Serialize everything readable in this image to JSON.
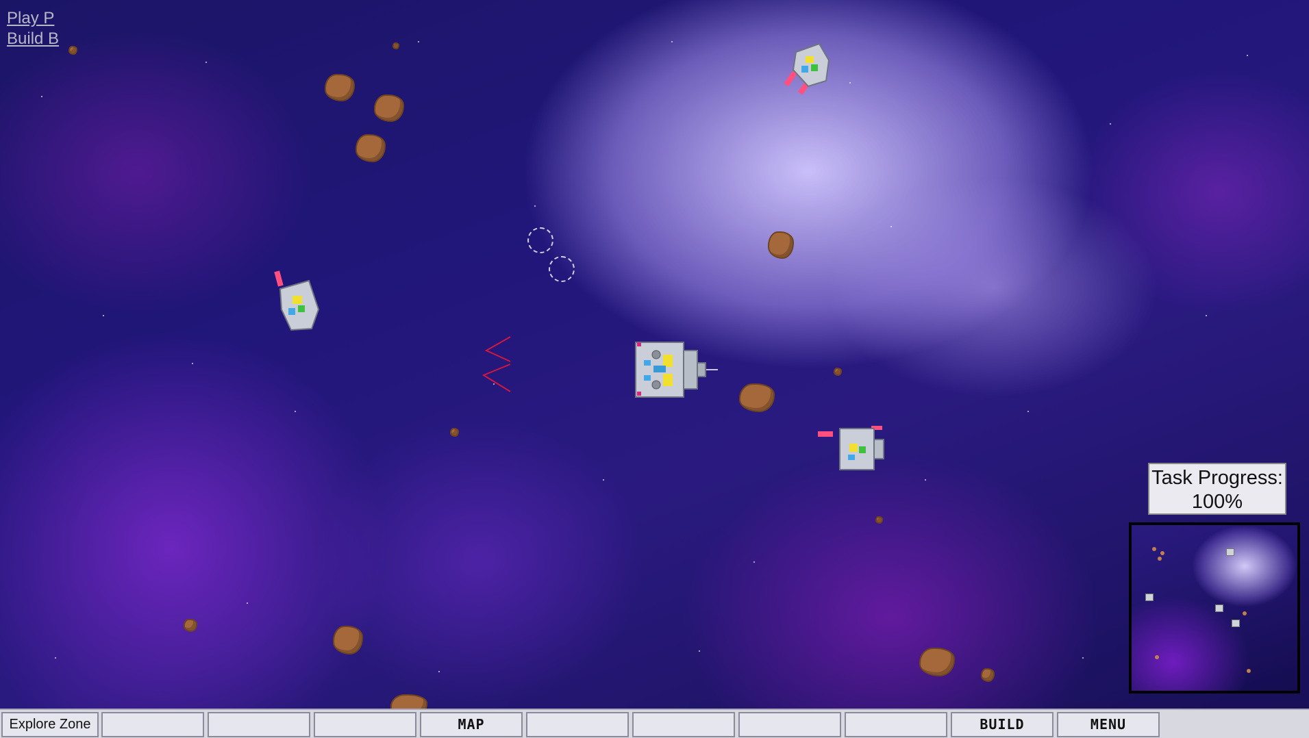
{
  "hints": {
    "play": "Play P",
    "build": "Build B"
  },
  "task": {
    "label": "Task Progress:",
    "value": "100%"
  },
  "toolbar": {
    "buttons": [
      "Explore Zone",
      "",
      "",
      "",
      "MAP",
      "",
      "",
      "",
      "",
      "BUILD",
      "MENU"
    ]
  },
  "colors": {
    "asteroid": "#a4683a",
    "nebula_light": "#d2c8ff",
    "nebula_purple": "#7828c8",
    "laser": "#ff5080",
    "toolbar": "#d8d8e0"
  },
  "icons": [
    "player-ship-icon",
    "enemy-ship-icon",
    "asteroid-icon",
    "target-reticle-icon",
    "waypoint-chevron-icon"
  ]
}
